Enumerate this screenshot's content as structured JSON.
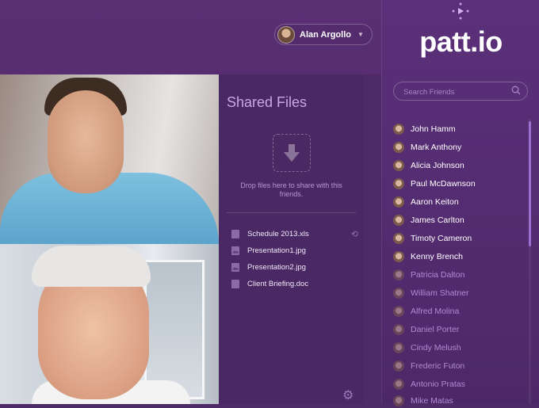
{
  "user": {
    "name": "Alan Argollo"
  },
  "files_panel": {
    "title": "Shared Files",
    "drop_text": "Drop files here to share with this friends.",
    "files": [
      {
        "name": "Schedule 2013.xls",
        "type": "doc-icon",
        "syncing": true
      },
      {
        "name": "Presentation1.jpg",
        "type": "image-icon"
      },
      {
        "name": "Presentation2.jpg",
        "type": "image-icon"
      },
      {
        "name": "Client Briefing.doc",
        "type": "doc-icon"
      }
    ]
  },
  "sidebar": {
    "logo": "patt.io",
    "search_placeholder": "Search Friends",
    "friends": [
      {
        "name": "John Hamm",
        "online": true
      },
      {
        "name": "Mark Anthony",
        "online": true
      },
      {
        "name": "Alicia Johnson",
        "online": true
      },
      {
        "name": "Paul McDawnson",
        "online": true
      },
      {
        "name": "Aaron Keiton",
        "online": true
      },
      {
        "name": "James Carlton",
        "online": true
      },
      {
        "name": "Timoty Cameron",
        "online": true
      },
      {
        "name": "Kenny Brench",
        "online": true
      },
      {
        "name": "Patricia Dalton",
        "online": false
      },
      {
        "name": "William Shatner",
        "online": false
      },
      {
        "name": "Alfred Molina",
        "online": false
      },
      {
        "name": "Daniel Porter",
        "online": false
      },
      {
        "name": "Cindy Melush",
        "online": false
      },
      {
        "name": "Frederic Futon",
        "online": false
      },
      {
        "name": "Antonio Pratas",
        "online": false
      },
      {
        "name": "Mike Matas",
        "online": false
      }
    ]
  },
  "colors": {
    "accent": "#9b6fd0",
    "background": "#4e2a66"
  }
}
